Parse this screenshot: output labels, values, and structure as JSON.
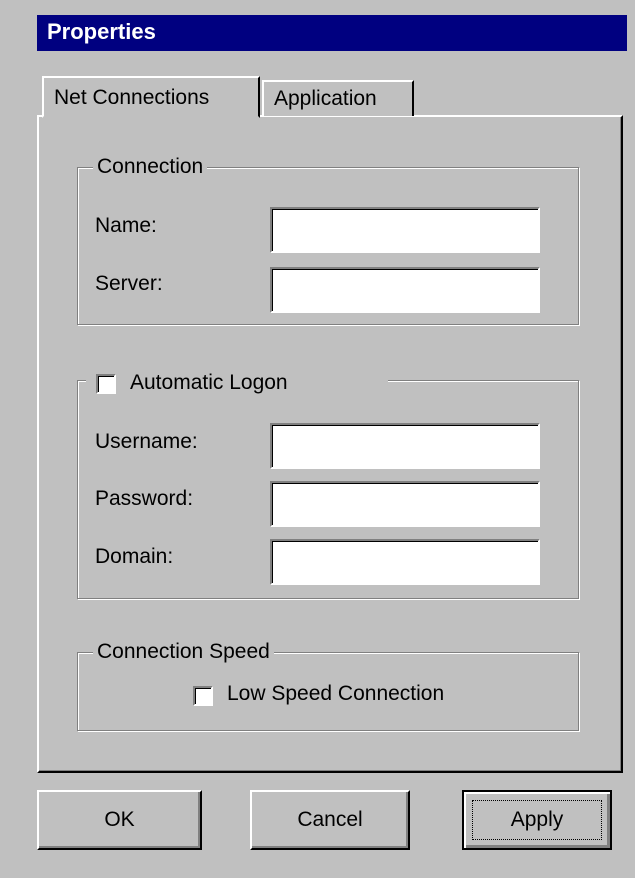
{
  "window": {
    "title": "Properties"
  },
  "tabs": [
    {
      "label": "Net Connections",
      "active": true
    },
    {
      "label": "Application",
      "active": false
    }
  ],
  "connection_group": {
    "legend": "Connection",
    "name_label": "Name:",
    "name_value": "",
    "server_label": "Server:",
    "server_value": ""
  },
  "logon_group": {
    "checkbox_label": "Automatic Logon",
    "checked": false,
    "username_label": "Username:",
    "username_value": "",
    "password_label": "Password:",
    "password_value": "",
    "domain_label": "Domain:",
    "domain_value": ""
  },
  "speed_group": {
    "legend": "Connection Speed",
    "checkbox_label": "Low Speed Connection",
    "checked": false
  },
  "buttons": {
    "ok": "OK",
    "cancel": "Cancel",
    "apply": "Apply"
  },
  "colors": {
    "titlebar": "#000080",
    "face": "#c0c0c0",
    "shadow": "#808080",
    "highlight": "#ffffff"
  }
}
